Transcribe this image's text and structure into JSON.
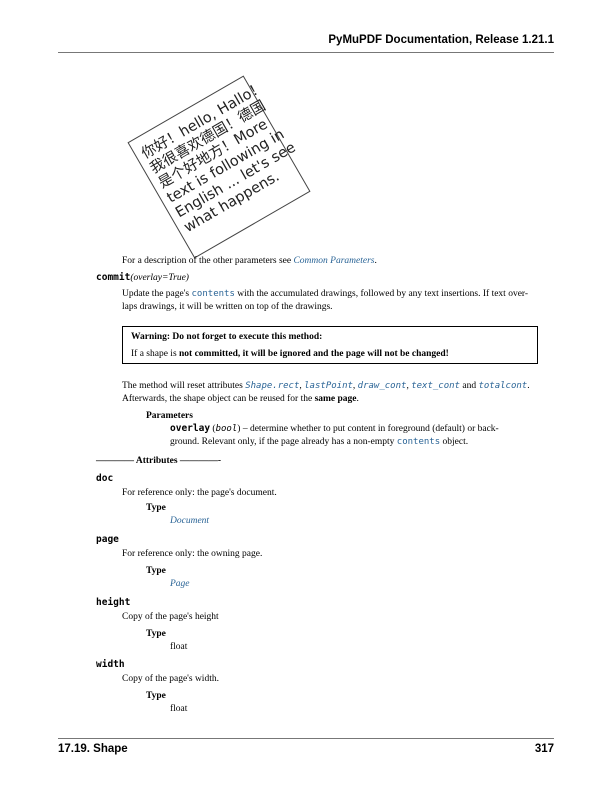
{
  "header": {
    "title": "PyMuPDF Documentation, Release 1.21.1"
  },
  "figure": {
    "lines": [
      "你好！hello, Hallo！",
      "我很喜欢德国！德国",
      "是个好地方！More",
      "text is following in",
      "English ... let's see",
      "what happens."
    ]
  },
  "intro": {
    "prefix": "For a description of the other parameters see ",
    "link": "Common Parameters",
    "suffix": "."
  },
  "commit": {
    "name": "commit",
    "params": "(overlay=True)",
    "desc1_a": "Update the page's ",
    "desc1_code": "contents",
    "desc1_b": " with the accumulated drawings, followed by any text insertions. If text over-",
    "desc2": "laps drawings, it will be written on top of the drawings.",
    "warning_title": "Warning:   Do not forget to execute this method:",
    "warning_body_a": "If a shape is ",
    "warning_body_b": "not committed, it will be ignored and the page will not be changed!",
    "reset_a": "The method will reset attributes ",
    "reset_c1": "Shape.rect",
    "reset_sep1": ", ",
    "reset_c2": "lastPoint",
    "reset_sep2": ", ",
    "reset_c3": "draw_cont",
    "reset_sep3": ", ",
    "reset_c4": "text_cont",
    "reset_and": " and ",
    "reset_c5": "totalcont",
    "reset_end": ".",
    "after_a": "Afterwards, the shape object can be reused for the ",
    "after_b": "same page",
    "after_end": ".",
    "params_label": "Parameters",
    "param_name": "overlay",
    "param_type": "bool",
    "param_desc1": " – determine whether to put content in foreground (default) or back-",
    "param_desc2_a": "ground. Relevant only, if the page already has a non-empty ",
    "param_desc2_code": "contents",
    "param_desc2_b": " object."
  },
  "attributes_heading": "———— Attributes ————-",
  "attributes": [
    {
      "name": "doc",
      "desc": "For reference only: the page's document.",
      "type_label": "Type",
      "type": "Document",
      "type_link": true
    },
    {
      "name": "page",
      "desc": "For reference only: the owning page.",
      "type_label": "Type",
      "type": "Page",
      "type_link": true
    },
    {
      "name": "height",
      "desc": "Copy of the page's height",
      "type_label": "Type",
      "type": "float",
      "type_link": false
    },
    {
      "name": "width",
      "desc": "Copy of the page's width.",
      "type_label": "Type",
      "type": "float",
      "type_link": false
    }
  ],
  "footer": {
    "left": "17.19.  Shape",
    "right": "317"
  }
}
